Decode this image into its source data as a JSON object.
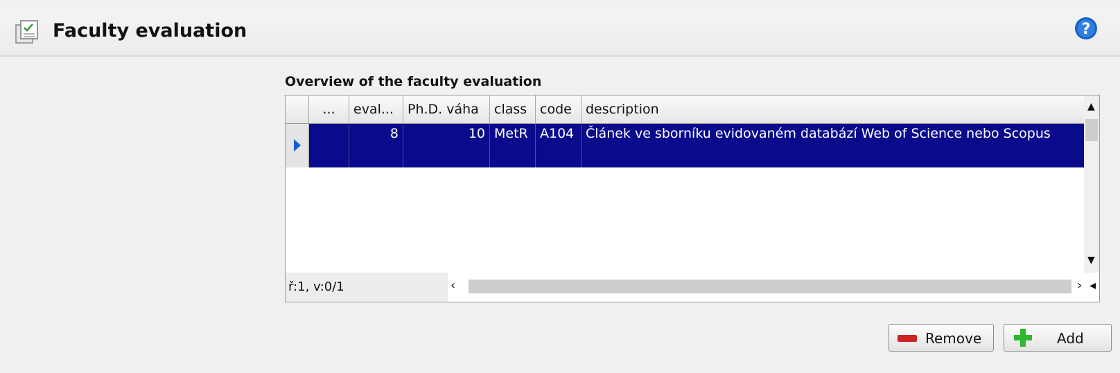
{
  "header": {
    "title": "Faculty evaluation",
    "icon": "form-checklist-icon",
    "help_icon": "help-icon"
  },
  "section": {
    "title": "Overview of the faculty evaluation"
  },
  "table": {
    "columns": [
      "...",
      "eval...",
      "Ph.D. váha",
      "class",
      "code",
      "description"
    ],
    "rows": [
      {
        "dots": "",
        "eval": "8",
        "phd_vaha": "10",
        "class": "MetR",
        "code": "A104",
        "description": "Článek ve sborníku evidovaném databází Web of Science nebo Scopus"
      }
    ]
  },
  "status": {
    "text": "ř:1, v:0/1"
  },
  "buttons": {
    "remove": "Remove",
    "add": "Add"
  },
  "colors": {
    "selection": "#0a0a8c",
    "remove_icon": "#cc2222",
    "add_icon": "#2db82d",
    "help": "#1560c8"
  }
}
